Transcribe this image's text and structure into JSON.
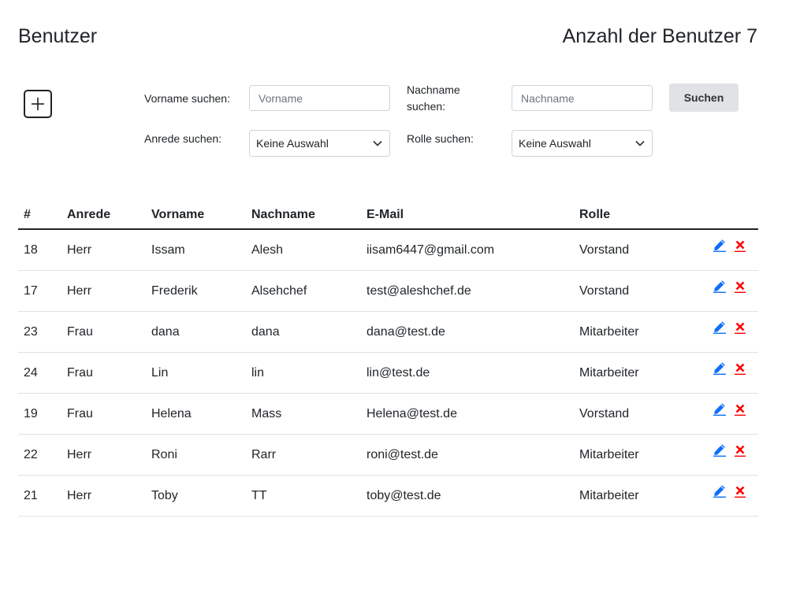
{
  "header": {
    "title": "Benutzer",
    "count_label": "Anzahl der Benutzer",
    "count_value": "7"
  },
  "filters": {
    "vorname_label": "Vorname suchen:",
    "vorname_placeholder": "Vorname",
    "nachname_label_line1": "Nachname",
    "nachname_label_line2": "suchen:",
    "nachname_placeholder": "Nachname",
    "anrede_label": "Anrede suchen:",
    "anrede_selected": "Keine Auswahl",
    "rolle_label": "Rolle suchen:",
    "rolle_selected": "Keine Auswahl",
    "search_button": "Suchen"
  },
  "table": {
    "columns": [
      "#",
      "Anrede",
      "Vorname",
      "Nachname",
      "E-Mail",
      "Rolle"
    ],
    "rows": [
      {
        "id": "18",
        "anrede": "Herr",
        "vorname": "Issam",
        "nachname": "Alesh",
        "email": "iisam6447@gmail.com",
        "rolle": "Vorstand"
      },
      {
        "id": "17",
        "anrede": "Herr",
        "vorname": "Frederik",
        "nachname": "Alsehchef",
        "email": "test@aleshchef.de",
        "rolle": "Vorstand"
      },
      {
        "id": "23",
        "anrede": "Frau",
        "vorname": "dana",
        "nachname": "dana",
        "email": "dana@test.de",
        "rolle": "Mitarbeiter"
      },
      {
        "id": "24",
        "anrede": "Frau",
        "vorname": "Lin",
        "nachname": "lin",
        "email": "lin@test.de",
        "rolle": "Mitarbeiter"
      },
      {
        "id": "19",
        "anrede": "Frau",
        "vorname": "Helena",
        "nachname": "Mass",
        "email": "Helena@test.de",
        "rolle": "Vorstand"
      },
      {
        "id": "22",
        "anrede": "Herr",
        "vorname": "Roni",
        "nachname": "Rarr",
        "email": "roni@test.de",
        "rolle": "Mitarbeiter"
      },
      {
        "id": "21",
        "anrede": "Herr",
        "vorname": "Toby",
        "nachname": "TT",
        "email": "toby@test.de",
        "rolle": "Mitarbeiter"
      }
    ]
  },
  "icons": {
    "add": "plus-square-icon",
    "edit": "pencil-icon",
    "delete": "x-icon",
    "dropdown": "chevron-down-icon"
  },
  "colors": {
    "edit_icon": "#0d6efd",
    "delete_icon": "#ff0000",
    "search_button_bg": "#e0e2e5"
  }
}
